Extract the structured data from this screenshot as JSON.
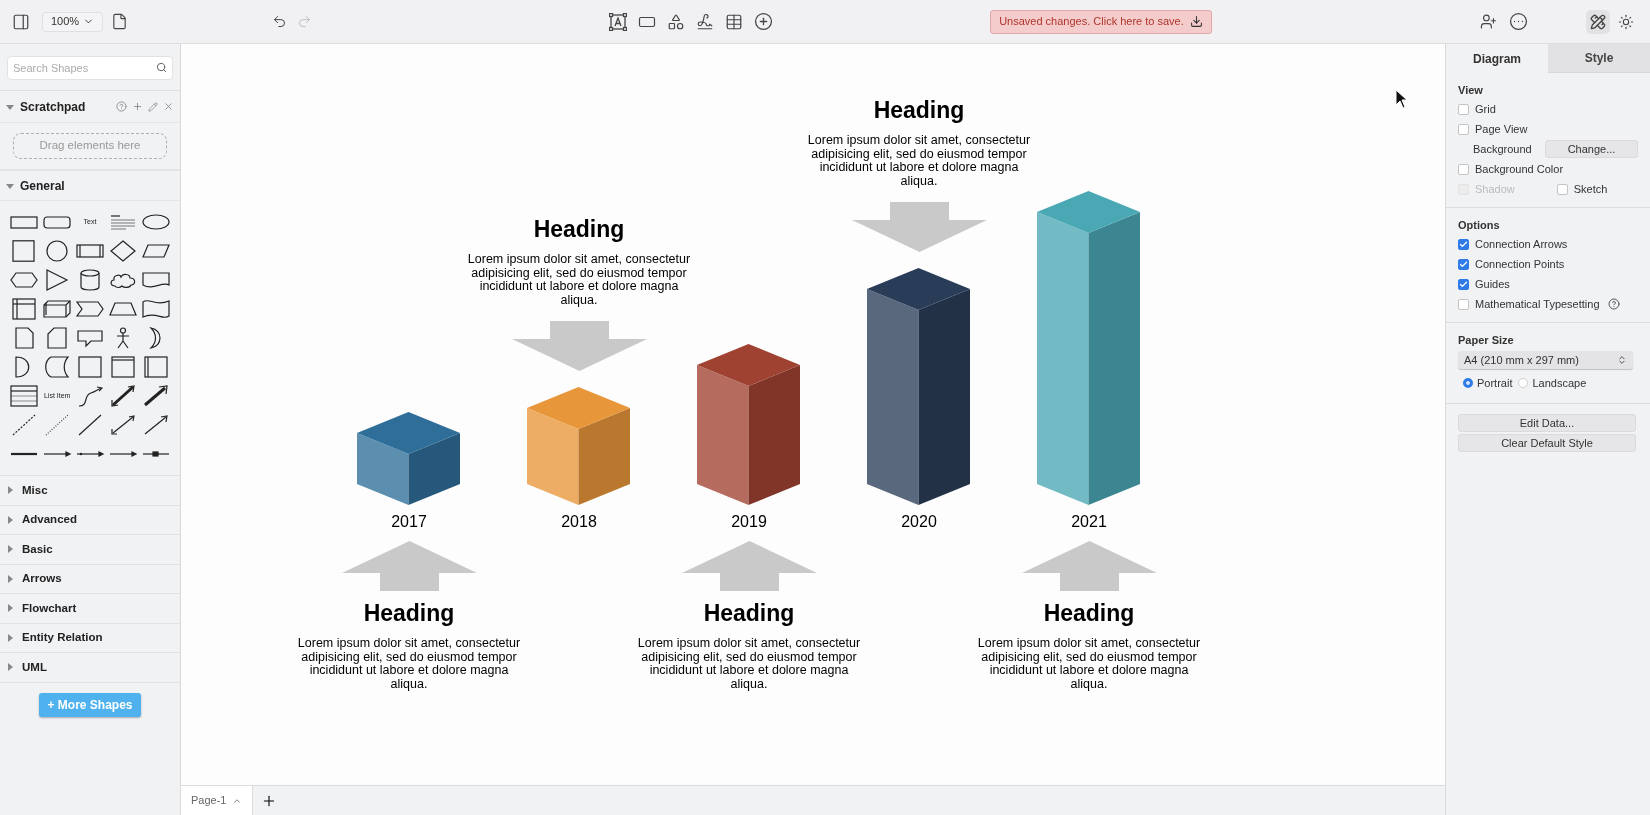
{
  "toolbar": {
    "zoom": "100%",
    "save_banner": "Unsaved changes. Click here to save."
  },
  "sidebar": {
    "search": {
      "placeholder": "Search Shapes"
    },
    "scratchpad": {
      "title": "Scratchpad",
      "expanded": true,
      "drop_hint": "Drag elements here"
    },
    "general": {
      "title": "General",
      "expanded": true,
      "text_shape": "Text",
      "list_item_shape": "List Item"
    },
    "sections": [
      {
        "title": "Misc",
        "expanded": false
      },
      {
        "title": "Advanced",
        "expanded": false
      },
      {
        "title": "Basic",
        "expanded": false
      },
      {
        "title": "Arrows",
        "expanded": false
      },
      {
        "title": "Flowchart",
        "expanded": false
      },
      {
        "title": "Entity Relation",
        "expanded": false
      },
      {
        "title": "UML",
        "expanded": false
      }
    ],
    "more_shapes": "+ More Shapes"
  },
  "canvas": {
    "bars": [
      {
        "kind": "below",
        "year": "2017",
        "color": "#2e6e98",
        "callout": {
          "heading": "Heading",
          "text": "Lorem ipsum dolor sit amet, consectetur adipisicing elit, sed do eiusmod tempor incididunt ut labore et dolore magna aliqua."
        }
      },
      {
        "kind": "above",
        "year": "2018",
        "color": "#e8963a",
        "callout": {
          "heading": "Heading",
          "text": "Lorem ipsum dolor sit amet, consectetur adipisicing elit, sed do eiusmod tempor incididunt ut labore et dolore magna aliqua."
        }
      },
      {
        "kind": "below",
        "year": "2019",
        "color": "#a04232",
        "callout": {
          "heading": "Heading",
          "text": "Lorem ipsum dolor sit amet, consectetur adipisicing elit, sed do eiusmod tempor incididunt ut labore et dolore magna aliqua."
        }
      },
      {
        "kind": "above",
        "year": "2020",
        "color": "#2a3d58",
        "callout": {
          "heading": "Heading",
          "text": "Lorem ipsum dolor sit amet, consectetur adipisicing elit, sed do eiusmod tempor incididunt ut labore et dolore magna aliqua."
        }
      },
      {
        "kind": "below",
        "year": "2021",
        "color": "#4aa8b5",
        "callout": {
          "heading": "Heading",
          "text": "Lorem ipsum dolor sit amet, consectetur adipisicing elit, sed do eiusmod tempor incididunt ut labore et dolore magna aliqua."
        }
      }
    ]
  },
  "page_tabs": [
    {
      "label": "Page-1",
      "selected": true
    }
  ],
  "format_panel": {
    "tabs": [
      {
        "label": "Diagram",
        "selected": true
      },
      {
        "label": "Style",
        "selected": false
      }
    ],
    "view": {
      "title": "View",
      "grid": {
        "label": "Grid",
        "checked": false
      },
      "page_view": {
        "label": "Page View",
        "checked": false
      },
      "background": {
        "label": "Background",
        "button": "Change..."
      },
      "background_color": {
        "label": "Background Color",
        "checked": false
      },
      "shadow": {
        "label": "Shadow",
        "checked": false,
        "disabled": true
      },
      "sketch": {
        "label": "Sketch",
        "checked": false,
        "disabled": false
      }
    },
    "options": {
      "title": "Options",
      "items": [
        {
          "label": "Connection Arrows",
          "checked": true
        },
        {
          "label": "Connection Points",
          "checked": true
        },
        {
          "label": "Guides",
          "checked": true
        },
        {
          "label": "Mathematical Typesetting",
          "checked": false,
          "help": true
        }
      ]
    },
    "paper_size": {
      "title": "Paper Size",
      "value": "A4 (210 mm x 297 mm)",
      "orientations": [
        {
          "label": "Portrait",
          "selected": true
        },
        {
          "label": "Landscape",
          "selected": false
        }
      ]
    },
    "buttons": [
      "Edit Data...",
      "Clear Default Style"
    ]
  }
}
